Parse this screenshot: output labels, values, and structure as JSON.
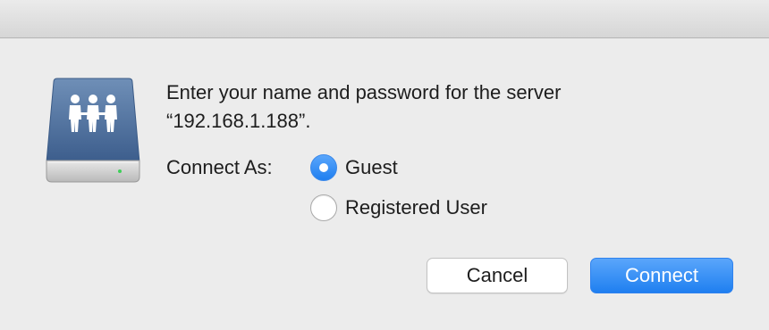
{
  "dialog": {
    "message_line1": "Enter your name and password for the server",
    "message_line2": "“192.168.1.188”.",
    "icon": "shared-server-icon",
    "connect_as": {
      "label": "Connect As:",
      "options": [
        {
          "label": "Guest",
          "selected": true
        },
        {
          "label": "Registered User",
          "selected": false
        }
      ]
    },
    "buttons": {
      "cancel": "Cancel",
      "connect": "Connect"
    }
  },
  "colors": {
    "accent": "#2f88f6",
    "window_bg": "#ececec",
    "text": "#1d1d1d"
  }
}
